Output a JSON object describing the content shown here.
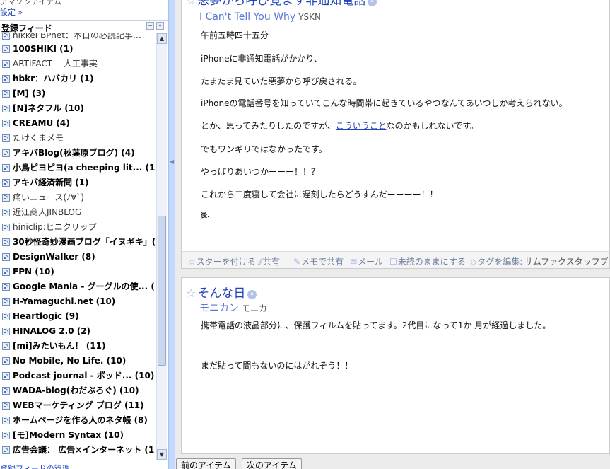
{
  "sidebar": {
    "top_line": "アマゾンアイテム",
    "settings_link": "設定 »",
    "feeds_title": "登録フィード",
    "collapse_btn": "−",
    "menu_btn": "▾",
    "manage_link": "登録フィードの管理",
    "feeds": [
      {
        "label": "nikkei BPnet：本日の必読記事…",
        "unread": false
      },
      {
        "label": "100SHIKI (1)",
        "unread": true
      },
      {
        "label": "ARTIFACT ―人工事実―",
        "unread": false
      },
      {
        "label": "hbkr：ハバカリ (1)",
        "unread": true
      },
      {
        "label": "[M] (3)",
        "unread": true
      },
      {
        "label": "[N]ネタフル (10)",
        "unread": true
      },
      {
        "label": "CREAMU (4)",
        "unread": true
      },
      {
        "label": "たけくまメモ",
        "unread": false
      },
      {
        "label": "アキバBlog(秋葉原ブログ) (4)",
        "unread": true
      },
      {
        "label": "小鳥ピヨピヨ(a cheeping lit... (1)",
        "unread": true
      },
      {
        "label": "アキバ経済新聞 (1)",
        "unread": true
      },
      {
        "label": "痛いニュース(ﾉ∀`)",
        "unread": false
      },
      {
        "label": "近江商人JINBLOG",
        "unread": false
      },
      {
        "label": "hiniclip:ヒニクリップ",
        "unread": false
      },
      {
        "label": "30秒怪奇妙漫画ブログ「イヌギキ」(",
        "unread": true
      },
      {
        "label": "DesignWalker (8)",
        "unread": true
      },
      {
        "label": "FPN (10)",
        "unread": true
      },
      {
        "label": "Google Mania - グーグルの使... (",
        "unread": true
      },
      {
        "label": "H-Yamaguchi.net (10)",
        "unread": true
      },
      {
        "label": "Heartlogic (9)",
        "unread": true
      },
      {
        "label": "HINALOG 2.0 (2)",
        "unread": true
      },
      {
        "label": "[mi]みたいもん！ (11)",
        "unread": true
      },
      {
        "label": "No Mobile, No Life. (10)",
        "unread": true
      },
      {
        "label": "Podcast journal - ポッド... (10)",
        "unread": true
      },
      {
        "label": "WADA-blog(わだぶろぐ) (10)",
        "unread": true
      },
      {
        "label": "WEBマーケティング ブログ (11)",
        "unread": true
      },
      {
        "label": "ホームページを作る人のネタ帳 (8)",
        "unread": true
      },
      {
        "label": "[モ]Modern Syntax (10)",
        "unread": true
      },
      {
        "label": "広告会議： 広告×インターネット (1",
        "unread": true
      }
    ]
  },
  "entries": [
    {
      "title": "悪夢から呼び覚ます非通知電話",
      "source": "I Can't Tell You Why",
      "author": "YSKN",
      "lines": [
        "午前五時四十五分",
        "iPhoneに非通知電話がかかり、",
        "たまたま見ていた悪夢から呼び戻される。",
        "iPhoneの電話番号を知っていてこんな時間帯に起きているやつなんてあいつしか考えられない。",
        "とか、思ってみたりしたのですが、",
        "こういうこと",
        "なのかもしれないです。",
        "でもワンギリではなかったです。",
        "やっぱりあいつかーーー！！？",
        "これから二度寝して会社に遅刻したらどうすんだーーーー！！"
      ],
      "signature": "後."
    },
    {
      "title": "そんな日",
      "source": "モニカン",
      "author": "モニカ",
      "lines": [
        "携帯電話の液晶部分に、保護フィルムを貼ってます。2代目になって1か 月が経過しました。",
        "まだ貼って間もないのにはがれそう！！"
      ]
    }
  ],
  "actions": {
    "star": "スターを付ける",
    "share": "共有",
    "share_note": "メモで共有",
    "email": "メール",
    "keep_unread": "未読のままにする",
    "edit_tags": "タグを編集:",
    "tag_value": "サムファクスタッフブログ"
  },
  "nav": {
    "prev": "前のアイテム",
    "next": "次のアイテム"
  }
}
